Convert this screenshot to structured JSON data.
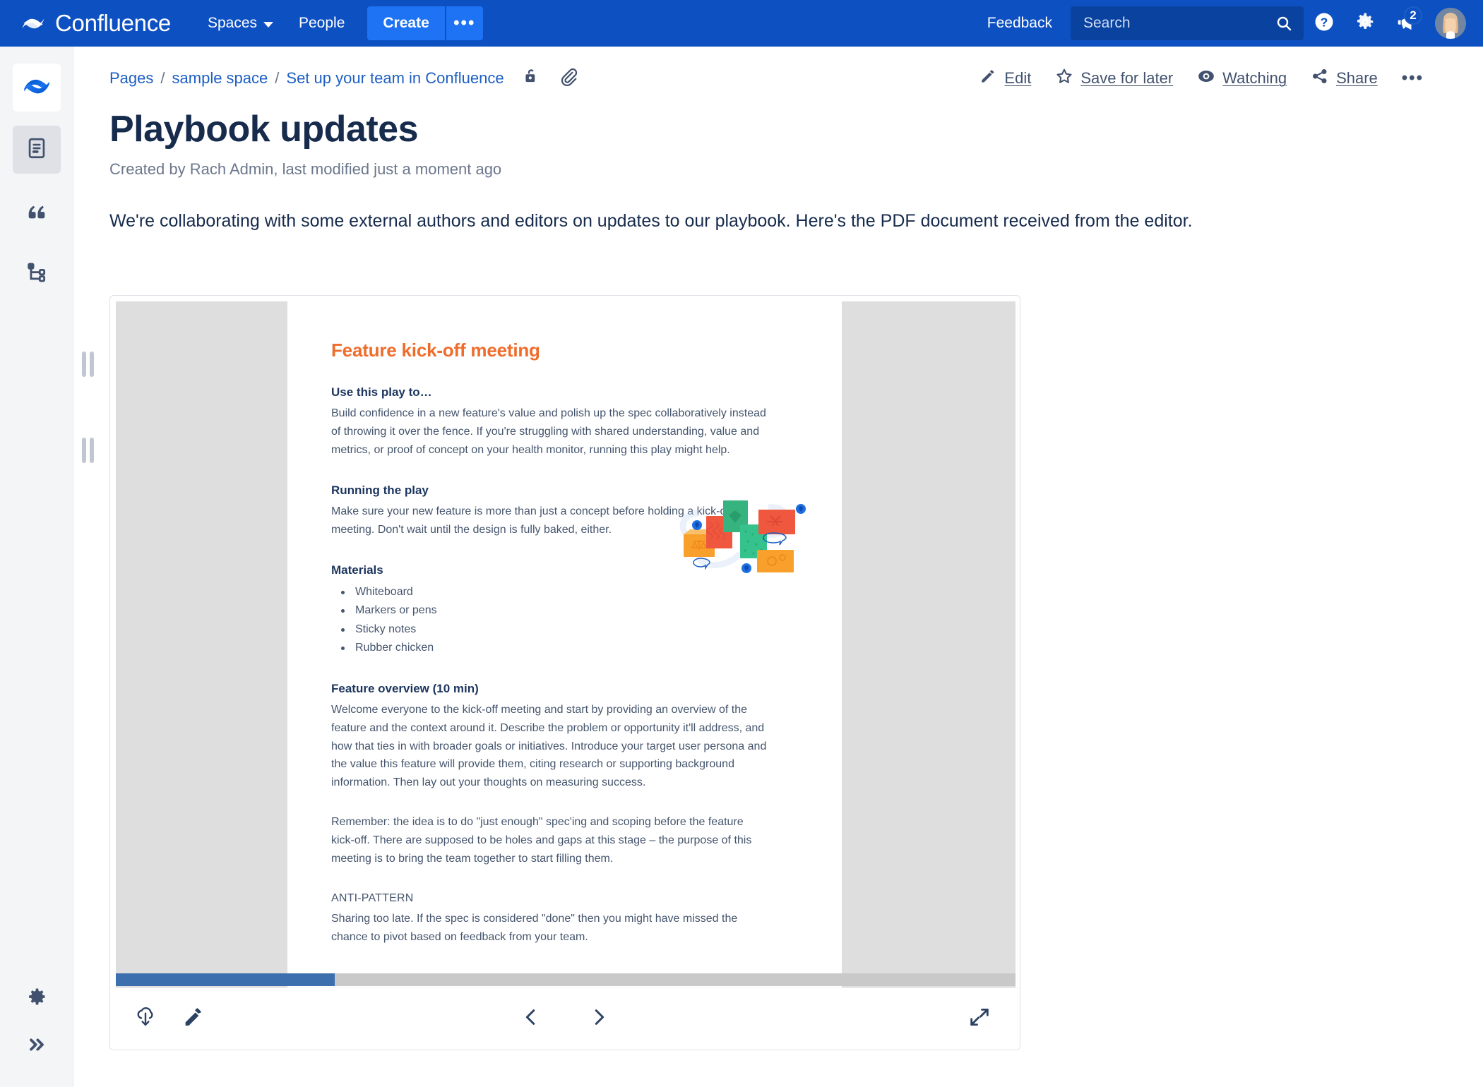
{
  "topnav": {
    "brand": "Confluence",
    "brand_logo_icon": "confluence-logo-icon",
    "spaces_label": "Spaces",
    "people_label": "People",
    "create_label": "Create",
    "create_more_icon": "ellipsis-icon",
    "feedback_label": "Feedback",
    "search_placeholder": "Search",
    "search_value": "",
    "search_icon": "search-icon",
    "help_icon": "help-circle-icon",
    "settings_icon": "gear-icon",
    "notifications_icon": "megaphone-icon",
    "notifications_count": "2",
    "avatar_icon": "user-avatar",
    "bg_color": "#0d50c2",
    "create_color": "#1d73f3"
  },
  "rail": {
    "items": [
      {
        "name": "confluence-home-logo",
        "icon": "confluence-logo-icon",
        "active": false
      },
      {
        "name": "pages",
        "icon": "page-document-icon",
        "active": true
      },
      {
        "name": "blog",
        "icon": "quote-icon",
        "active": false
      },
      {
        "name": "page-tree",
        "icon": "tree-hierarchy-icon",
        "active": false
      }
    ],
    "settings_icon": "gear-icon",
    "expand_icon": "double-chevron-right-icon"
  },
  "breadcrumb": {
    "items": [
      {
        "label": "Pages"
      },
      {
        "label": "sample space"
      },
      {
        "label": "Set up your team in Confluence"
      }
    ],
    "separator": "/",
    "restrictions_icon": "unlocked-padlock-icon",
    "attachments_icon": "paperclip-icon"
  },
  "page_actions": [
    {
      "label": "Edit",
      "icon": "pencil-icon",
      "underline": "E"
    },
    {
      "label": "Save for later",
      "icon": "star-icon",
      "underline": "f"
    },
    {
      "label": "Watching",
      "icon": "eye-icon",
      "underline": "W"
    },
    {
      "label": "Share",
      "icon": "share-icon",
      "underline": "S"
    }
  ],
  "page_actions_more_icon": "ellipsis-icon",
  "page": {
    "title": "Playbook updates",
    "meta": "Created by Rach Admin, last modified just a moment ago",
    "body_paragraph": "We're collaborating with some external authors and editors on updates to our playbook.  Here's the PDF document received from the editor."
  },
  "pdf_preview": {
    "heading": "Feature kick-off meeting",
    "heading_color": "#ef6c2b",
    "sections": [
      {
        "heading": "Use this play to…",
        "body": "Build confidence in a new feature's value and polish up the spec collaboratively instead of throwing it over the fence. If you're struggling with shared understanding, value and metrics, or proof of concept on your health monitor, running this play might help."
      },
      {
        "heading": "Running the play",
        "body": "Make sure your new feature is more than just a concept before holding a kick-off meeting. Don't wait until the design is fully baked, either."
      }
    ],
    "materials_heading": "Materials",
    "materials": [
      "Whiteboard",
      "Markers or pens",
      "Sticky notes",
      "Rubber chicken"
    ],
    "overview_heading": "Feature overview (10 min)",
    "overview_body": "Welcome everyone to the kick-off meeting and start by providing an overview of the feature and the context around it. Describe the problem or opportunity it'll address, and how that ties in with broader goals or initiatives. Introduce your target user persona and the value this feature will provide them, citing research or supporting background information. Then lay out your thoughts on measuring success.",
    "remember_body": "Remember: the idea is to do \"just enough\" spec'ing and scoping before the feature kick-off. There are supposed to be holes and gaps at this stage – the purpose of this meeting is to bring the team together to start filling them.",
    "antipattern_heading": "ANTI-PATTERN",
    "antipattern_body": "Sharing too late. If the spec is considered \"done\" then you might have missed the chance to pivot based on feedback from your team.",
    "illustration_icon": "sticky-notes-illustration"
  },
  "viewer_toolbar": {
    "download_icon": "download-cloud-icon",
    "annotate_icon": "pencil-icon",
    "prev_icon": "chevron-left-icon",
    "next_icon": "chevron-right-icon",
    "fullscreen_icon": "expand-diagonal-icon",
    "scroll_thumb_color": "#3c6fad",
    "scroll_track_color": "#c9c9c9"
  }
}
